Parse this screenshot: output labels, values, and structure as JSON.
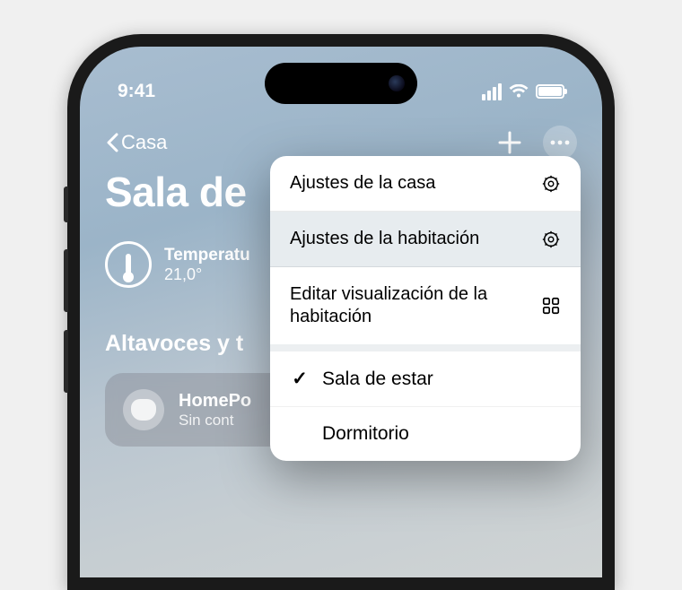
{
  "status": {
    "time": "9:41"
  },
  "nav": {
    "back_label": "Casa"
  },
  "page": {
    "title": "Sala de",
    "temperature_label": "Temperatu",
    "temperature_value": "21,0°",
    "section_title": "Altavoces y t",
    "tile_title": "HomePo",
    "tile_subtitle": "Sin cont"
  },
  "menu": {
    "items": [
      {
        "label": "Ajustes de la casa"
      },
      {
        "label": "Ajustes de la habitación"
      },
      {
        "label": "Editar visualización de la habitación"
      }
    ],
    "rooms": [
      {
        "label": "Sala de estar",
        "checked": true
      },
      {
        "label": "Dormitorio",
        "checked": false
      }
    ]
  }
}
